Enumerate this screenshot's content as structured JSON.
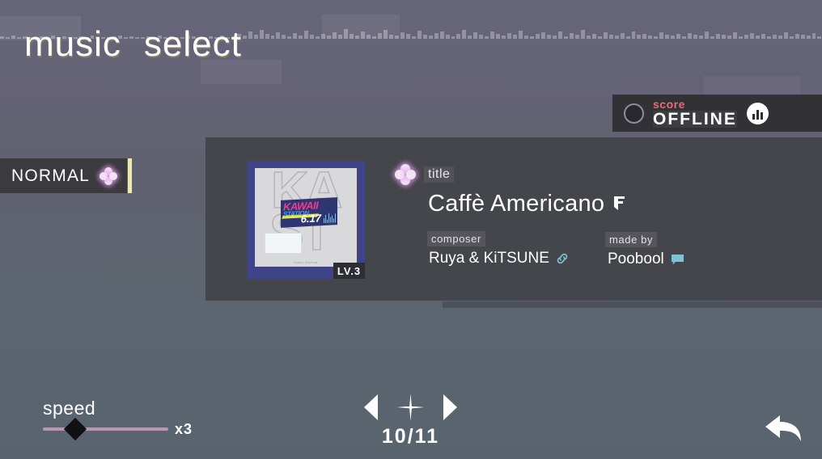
{
  "header": {
    "title_word1": "music",
    "title_word2": "select"
  },
  "score_panel": {
    "label": "score",
    "status": "OFFLINE",
    "chart_icon": "bar-chart-icon",
    "radio_icon": "radio-circle-icon"
  },
  "difficulty": {
    "label": "NORMAL",
    "icon": "clover-icon"
  },
  "song": {
    "title_label": "title",
    "title": "Caffè Americano",
    "title_flag_icon": "flag-icon",
    "composer_label": "composer",
    "composer": "Ruya & KiTSUNE",
    "composer_icon": "link-icon",
    "madeby_label": "made by",
    "madeby": "Poobool",
    "madeby_icon": "comment-icon",
    "level_badge": "LV.3",
    "title_clover_icon": "clover-icon"
  },
  "album_art": {
    "bg_letters_top": "KA",
    "bg_letters_bottom": "ST",
    "card_title": "KAWAII",
    "card_subtitle": "STATION",
    "card_date": "6.17",
    "credit": "KAWAII STATION"
  },
  "speed": {
    "label": "speed",
    "value": "x3"
  },
  "navigation": {
    "prev_icon": "chevron-left-icon",
    "next_icon": "chevron-right-icon",
    "sparkle_icon": "sparkle-icon",
    "counter": "10/11"
  },
  "back": {
    "icon": "back-arrow-icon"
  },
  "colors": {
    "accent_pink": "#f0697a",
    "clover_pink": "#e2a0eb",
    "link_cyan": "#79c5d6",
    "tab_edge_yellow": "#ece9b8",
    "slider_track": "#b897b4",
    "bg_top": "#67657a",
    "bg_bottom": "#59636d"
  }
}
